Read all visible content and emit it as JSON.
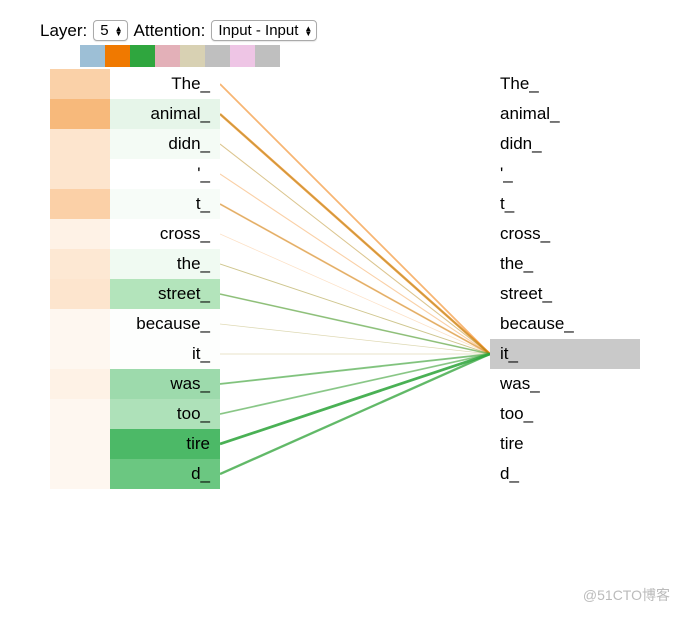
{
  "controls": {
    "layer_label": "Layer:",
    "layer_value": "5",
    "attention_label": "Attention:",
    "attention_value": "Input - Input"
  },
  "swatches": [
    "#9dbfd6",
    "#f07900",
    "#2fa63e",
    "#e3b0b8",
    "#d8d1b3",
    "#bfbfbf",
    "#eec5e5",
    "#bfbfbf"
  ],
  "tokens_left": [
    "The_",
    "animal_",
    "didn_",
    "'_",
    "t_",
    "cross_",
    "the_",
    "street_",
    "because_",
    "it_",
    "was_",
    "too_",
    "tire",
    "d_"
  ],
  "tokens_right": [
    "The_",
    "animal_",
    "didn_",
    "'_",
    "t_",
    "cross_",
    "the_",
    "street_",
    "because_",
    "it_",
    "was_",
    "too_",
    "tire",
    "d_"
  ],
  "selected_right_index": 9,
  "left_bar_colors": [
    "#fad1a8",
    "#f7b97b",
    "#fde5ce",
    "#fde5ce",
    "#fbd0a7",
    "#fef2e6",
    "#fde8d3",
    "#fde5ce",
    "#fef7f0",
    "#fef7f0",
    "#fef2e6",
    "#fef7f0",
    "#fef7f0",
    "#fef7f0"
  ],
  "left_cell_colors": [
    "#ffffff",
    "#e6f5e9",
    "#f4fbf5",
    "#ffffff",
    "#f7fcf8",
    "#ffffff",
    "#f0faf2",
    "#b3e4bb",
    "#fdfefd",
    "#fdfefd",
    "#9ddaac",
    "#aee1b9",
    "#4cb967",
    "#6bc781"
  ],
  "chart_data": {
    "type": "attention-lines",
    "description": "Attention from right-column token 'it_' (index 9) to each left-column token. Two heads shown (orange, green).",
    "source_token_index": 9,
    "heads": [
      {
        "name": "head-orange",
        "color_base": "#f07900",
        "weights_to_left": [
          0.5,
          0.75,
          0.25,
          0.25,
          0.5,
          0.1,
          0.22,
          0.22,
          0.08,
          0.08,
          0.12,
          0.08,
          0.08,
          0.08
        ]
      },
      {
        "name": "head-green",
        "color_base": "#2fa63e",
        "weights_to_left": [
          0.0,
          0.15,
          0.08,
          0.0,
          0.06,
          0.0,
          0.12,
          0.45,
          0.04,
          0.04,
          0.55,
          0.5,
          0.9,
          0.75
        ]
      }
    ]
  },
  "watermark": "@51CTO博客"
}
